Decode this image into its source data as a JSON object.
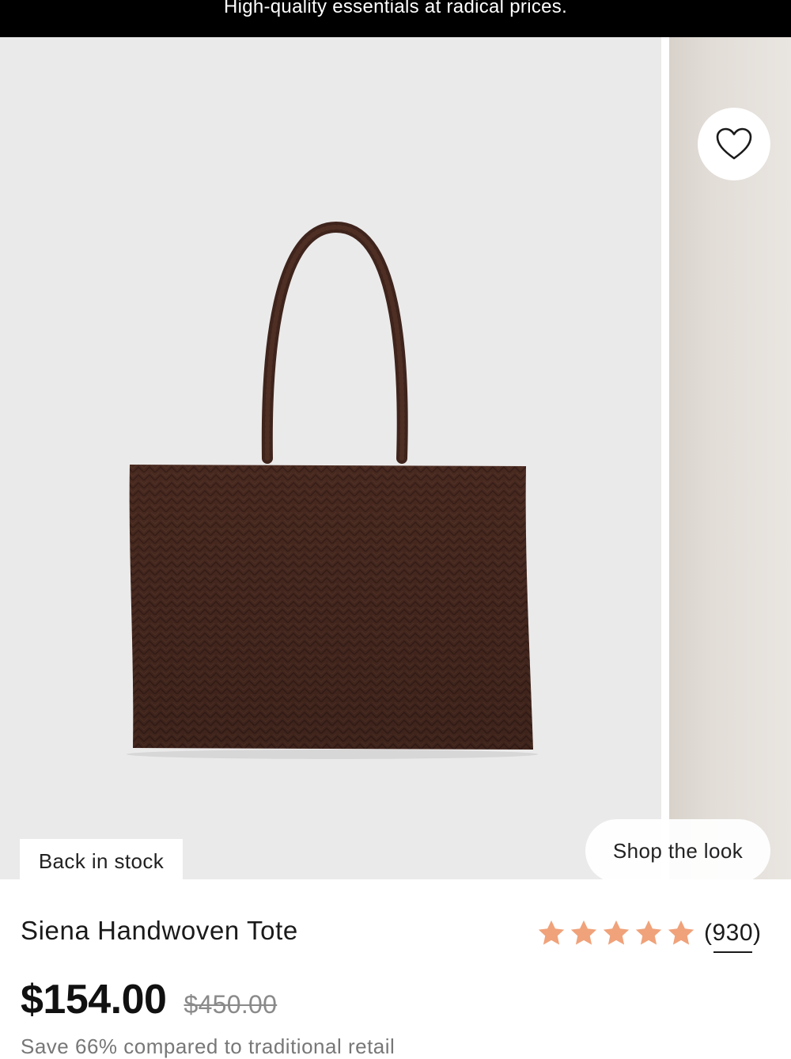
{
  "banner": {
    "text": "High-quality essentials at radical prices."
  },
  "gallery": {
    "badge": "Back in stock",
    "shop_the_look_label": "Shop the look",
    "wishlist_icon": "heart-icon",
    "product_image": "brown woven leather tote bag"
  },
  "product": {
    "title": "Siena Handwoven Tote",
    "rating": {
      "stars": 5,
      "star_icon": "star-icon",
      "star_color": "#f0a27a",
      "review_count": "(930)"
    },
    "price": "$154.00",
    "compare_price": "$450.00",
    "savings_text": "Save 66% compared to traditional retail"
  },
  "colors": {
    "banner_bg": "#000000",
    "image_bg": "#ebeaea",
    "bag_brown": "#4a2a20"
  }
}
